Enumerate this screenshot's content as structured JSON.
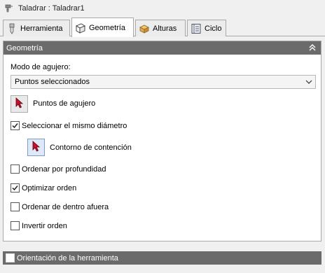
{
  "window": {
    "title": "Taladrar : Taladrar1",
    "title_icon": "drill-icon"
  },
  "tabs": [
    {
      "label": "Herramienta",
      "icon": "tool-icon",
      "active": false
    },
    {
      "label": "Geometría",
      "icon": "geometry-cube-icon",
      "active": true
    },
    {
      "label": "Alturas",
      "icon": "heights-icon",
      "active": false
    },
    {
      "label": "Ciclo",
      "icon": "cycle-icon",
      "active": false
    }
  ],
  "geometry_panel": {
    "header": "Geometría",
    "collapse_icon": "double-chevron-up-icon",
    "hole_mode": {
      "label": "Modo de agujero:",
      "selected": "Puntos seleccionados"
    },
    "hole_points": {
      "label": "Puntos de agujero",
      "icon": "select-arrow-icon"
    },
    "same_diameter": {
      "label": "Seleccionar el mismo diámetro",
      "checked": true
    },
    "containment_boundary": {
      "label": "Contorno de contención",
      "icon": "select-arrow-icon"
    },
    "sort_by_depth": {
      "label": "Ordenar por profundidad",
      "checked": false
    },
    "optimize_order": {
      "label": "Optimizar orden",
      "checked": true
    },
    "sort_inside_out": {
      "label": "Ordenar de dentro afuera",
      "checked": false
    },
    "reverse_order": {
      "label": "Invertir orden",
      "checked": false
    }
  },
  "tool_orientation_panel": {
    "header": "Orientación de la herramienta",
    "checked": false
  },
  "colors": {
    "panel_header": "#6b6b6b",
    "arrow_icon": "#b01e2e",
    "background": "#f0f0f0"
  }
}
